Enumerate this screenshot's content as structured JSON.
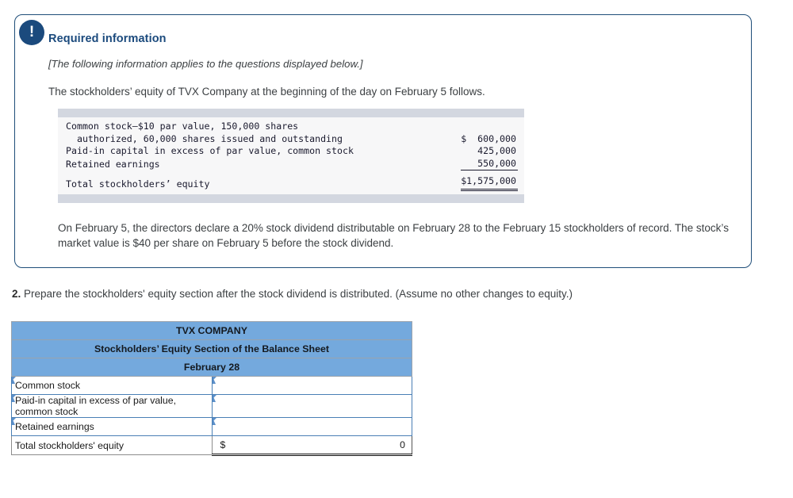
{
  "card": {
    "alert_icon": "exclamation-icon",
    "alert_glyph": "!",
    "title": "Required information",
    "applies_note": "[The following information applies to the questions displayed below.]",
    "intro": "The stockholders’ equity of TVX Company at the beginning of the day on February 5 follows.",
    "paragraph": "On February 5, the directors declare a 20% stock dividend distributable on February 28 to the February 15 stockholders of record. The stock’s market value is $40 per share on February 5 before the stock dividend."
  },
  "equity_table": {
    "rows": [
      {
        "label_line1": "Common stock—$10 par value, 150,000 shares",
        "label_line2": "  authorized, 60,000 shares issued and outstanding",
        "amount": "$  600,000",
        "underline": "none"
      },
      {
        "label_line1": "Paid-in capital in excess of par value, common stock",
        "label_line2": "",
        "amount": "   425,000",
        "underline": "none"
      },
      {
        "label_line1": "Retained earnings",
        "label_line2": "",
        "amount": "   550,000",
        "underline": "single"
      },
      {
        "label_line1": "Total stockholders’ equity",
        "label_line2": "",
        "amount": "$1,575,000",
        "underline": "double"
      }
    ]
  },
  "question": {
    "number": "2.",
    "text": "Prepare the stockholders' equity section after the stock dividend is distributed. (Assume no other changes to equity.)"
  },
  "answer_table": {
    "headers": [
      "TVX COMPANY",
      "Stockholders’ Equity Section of the Balance Sheet",
      "February 28"
    ],
    "rows": [
      {
        "label": "Common stock",
        "currency": "",
        "value": "",
        "type": "input"
      },
      {
        "label": "Paid-in capital in excess of par value, common stock",
        "currency": "",
        "value": "",
        "type": "input"
      },
      {
        "label": "Retained earnings",
        "currency": "",
        "value": "",
        "type": "input"
      },
      {
        "label": "Total stockholders' equity",
        "currency": "$",
        "value": "0",
        "type": "total"
      }
    ]
  },
  "colors": {
    "card_border": "#1f4e79",
    "badge": "#1b4a7d",
    "title": "#1b4a7d",
    "header_blue": "#74a9dd",
    "input_border": "#4a7fb5",
    "mono_bar": "#d3d7e0",
    "mono_bg": "#f7f7f8"
  }
}
